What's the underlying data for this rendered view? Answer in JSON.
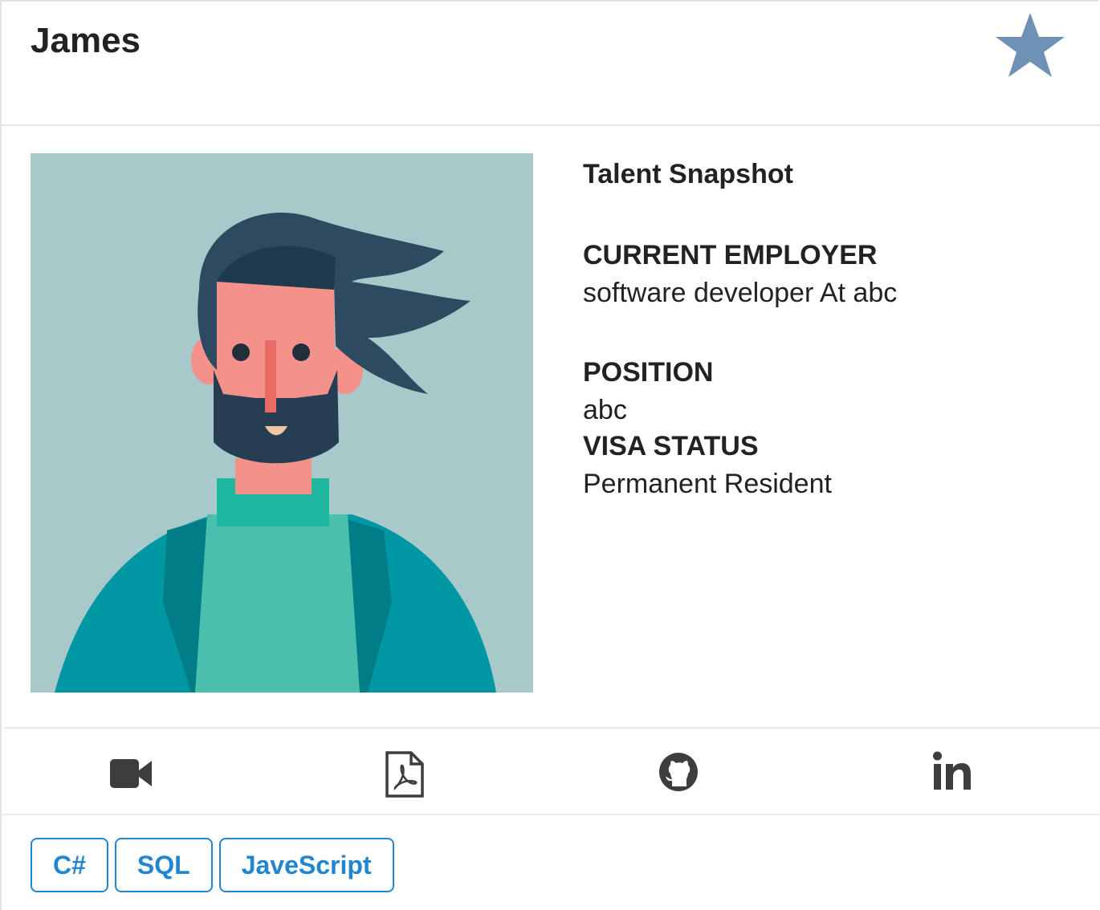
{
  "candidate": {
    "name": "James",
    "favorite_icon": "star-icon",
    "favorite_color": "#6f91b5"
  },
  "snapshot": {
    "title": "Talent Snapshot",
    "current_employer_label": "CURRENT EMPLOYER",
    "current_employer_value": "software developer At abc",
    "position_label": "POSITION",
    "position_value": "abc",
    "visa_label": "VISA STATUS",
    "visa_value": "Permanent Resident"
  },
  "links": [
    {
      "icon": "video-camera-icon"
    },
    {
      "icon": "pdf-file-icon"
    },
    {
      "icon": "github-icon"
    },
    {
      "icon": "linkedin-icon"
    }
  ],
  "skills": [
    "C#",
    "SQL",
    "JaveScript"
  ],
  "colors": {
    "accent": "#2185d0",
    "icon": "#3d3d3d",
    "avatar_bg": "#a8c9ca"
  }
}
